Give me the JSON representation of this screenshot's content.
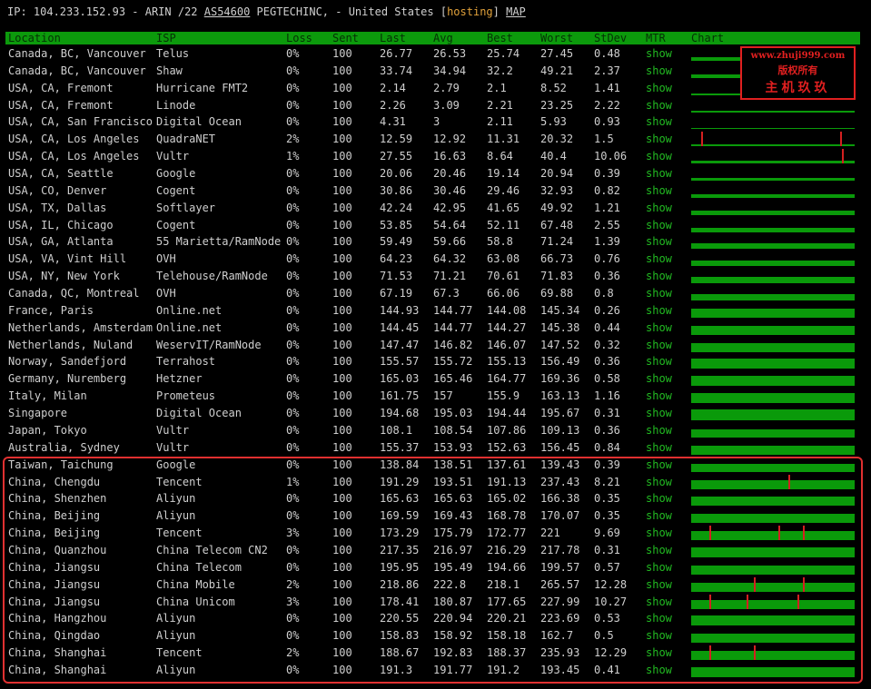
{
  "top": {
    "prefix": "IP: 104.233.152.93 - ARIN /22 ",
    "asn": "AS54600",
    "org": " PEGTECHINC, - United States [",
    "tag": "hosting",
    "close": "] ",
    "map": "MAP"
  },
  "columns": [
    "Location",
    "ISP",
    "Loss",
    "Sent",
    "Last",
    "Avg",
    "Best",
    "Worst",
    "StDev",
    "MTR",
    "Chart"
  ],
  "watermark": {
    "line1": "www.zhuji999.com",
    "line2": "版权所有",
    "line3": "主机玖玖"
  },
  "rows": [
    {
      "location": "Canada, BC, Vancouver",
      "isp": "Telus",
      "loss": "0%",
      "sent": "100",
      "last": "26.77",
      "avg": "26.53",
      "best": "25.74",
      "worst": "27.45",
      "stdev": "0.48",
      "mtr": "show",
      "chart": {
        "h": 4,
        "spikes": []
      }
    },
    {
      "location": "Canada, BC, Vancouver",
      "isp": "Shaw",
      "loss": "0%",
      "sent": "100",
      "last": "33.74",
      "avg": "34.94",
      "best": "32.2",
      "worst": "49.21",
      "stdev": "2.37",
      "mtr": "show",
      "chart": {
        "h": 4,
        "spikes": []
      }
    },
    {
      "location": "USA, CA, Fremont",
      "isp": "Hurricane FMT2",
      "loss": "0%",
      "sent": "100",
      "last": "2.14",
      "avg": "2.79",
      "best": "2.1",
      "worst": "8.52",
      "stdev": "1.41",
      "mtr": "show",
      "chart": {
        "h": 2,
        "spikes": []
      }
    },
    {
      "location": "USA, CA, Fremont",
      "isp": "Linode",
      "loss": "0%",
      "sent": "100",
      "last": "2.26",
      "avg": "3.09",
      "best": "2.21",
      "worst": "23.25",
      "stdev": "2.22",
      "mtr": "show",
      "chart": {
        "h": 2,
        "spikes": []
      }
    },
    {
      "location": "USA, CA, San Francisco",
      "isp": "Digital Ocean",
      "loss": "0%",
      "sent": "100",
      "last": "4.31",
      "avg": "3",
      "best": "2.11",
      "worst": "5.93",
      "stdev": "0.93",
      "mtr": "show",
      "chart": {
        "h": 1,
        "spikes": []
      }
    },
    {
      "location": "USA, CA, Los Angeles",
      "isp": "QuadraNET",
      "loss": "2%",
      "sent": "100",
      "last": "12.59",
      "avg": "12.92",
      "best": "11.31",
      "worst": "20.32",
      "stdev": "1.5",
      "mtr": "show",
      "chart": {
        "h": 2,
        "spikes": [
          6,
          92
        ]
      }
    },
    {
      "location": "USA, CA, Los Angeles",
      "isp": "Vultr",
      "loss": "1%",
      "sent": "100",
      "last": "27.55",
      "avg": "16.63",
      "best": "8.64",
      "worst": "40.4",
      "stdev": "10.06",
      "mtr": "show",
      "chart": {
        "h": 3,
        "spikes": [
          93
        ]
      }
    },
    {
      "location": "USA, CA, Seattle",
      "isp": "Google",
      "loss": "0%",
      "sent": "100",
      "last": "20.06",
      "avg": "20.46",
      "best": "19.14",
      "worst": "20.94",
      "stdev": "0.39",
      "mtr": "show",
      "chart": {
        "h": 3,
        "spikes": []
      }
    },
    {
      "location": "USA, CO, Denver",
      "isp": "Cogent",
      "loss": "0%",
      "sent": "100",
      "last": "30.86",
      "avg": "30.46",
      "best": "29.46",
      "worst": "32.93",
      "stdev": "0.82",
      "mtr": "show",
      "chart": {
        "h": 4,
        "spikes": []
      }
    },
    {
      "location": "USA, TX, Dallas",
      "isp": "Softlayer",
      "loss": "0%",
      "sent": "100",
      "last": "42.24",
      "avg": "42.95",
      "best": "41.65",
      "worst": "49.92",
      "stdev": "1.21",
      "mtr": "show",
      "chart": {
        "h": 5,
        "spikes": []
      }
    },
    {
      "location": "USA, IL, Chicago",
      "isp": "Cogent",
      "loss": "0%",
      "sent": "100",
      "last": "53.85",
      "avg": "54.64",
      "best": "52.11",
      "worst": "67.48",
      "stdev": "2.55",
      "mtr": "show",
      "chart": {
        "h": 5,
        "spikes": []
      }
    },
    {
      "location": "USA, GA, Atlanta",
      "isp": "55 Marietta/RamNode",
      "loss": "0%",
      "sent": "100",
      "last": "59.49",
      "avg": "59.66",
      "best": "58.8",
      "worst": "71.24",
      "stdev": "1.39",
      "mtr": "show",
      "chart": {
        "h": 6,
        "spikes": []
      }
    },
    {
      "location": "USA, VA, Vint Hill",
      "isp": "OVH",
      "loss": "0%",
      "sent": "100",
      "last": "64.23",
      "avg": "64.32",
      "best": "63.08",
      "worst": "66.73",
      "stdev": "0.76",
      "mtr": "show",
      "chart": {
        "h": 6,
        "spikes": []
      }
    },
    {
      "location": "USA, NY, New York",
      "isp": "Telehouse/RamNode",
      "loss": "0%",
      "sent": "100",
      "last": "71.53",
      "avg": "71.21",
      "best": "70.61",
      "worst": "71.83",
      "stdev": "0.36",
      "mtr": "show",
      "chart": {
        "h": 7,
        "spikes": []
      }
    },
    {
      "location": "Canada, QC, Montreal",
      "isp": "OVH",
      "loss": "0%",
      "sent": "100",
      "last": "67.19",
      "avg": "67.3",
      "best": "66.06",
      "worst": "69.88",
      "stdev": "0.8",
      "mtr": "show",
      "chart": {
        "h": 7,
        "spikes": []
      }
    },
    {
      "location": "France, Paris",
      "isp": "Online.net",
      "loss": "0%",
      "sent": "100",
      "last": "144.93",
      "avg": "144.77",
      "best": "144.08",
      "worst": "145.34",
      "stdev": "0.26",
      "mtr": "show",
      "chart": {
        "h": 10,
        "spikes": []
      }
    },
    {
      "location": "Netherlands, Amsterdam",
      "isp": "Online.net",
      "loss": "0%",
      "sent": "100",
      "last": "144.45",
      "avg": "144.77",
      "best": "144.27",
      "worst": "145.38",
      "stdev": "0.44",
      "mtr": "show",
      "chart": {
        "h": 10,
        "spikes": []
      }
    },
    {
      "location": "Netherlands, Nuland",
      "isp": "WeservIT/RamNode",
      "loss": "0%",
      "sent": "100",
      "last": "147.47",
      "avg": "146.82",
      "best": "146.07",
      "worst": "147.52",
      "stdev": "0.32",
      "mtr": "show",
      "chart": {
        "h": 10,
        "spikes": []
      }
    },
    {
      "location": "Norway, Sandefjord",
      "isp": "Terrahost",
      "loss": "0%",
      "sent": "100",
      "last": "155.57",
      "avg": "155.72",
      "best": "155.13",
      "worst": "156.49",
      "stdev": "0.36",
      "mtr": "show",
      "chart": {
        "h": 11,
        "spikes": []
      }
    },
    {
      "location": "Germany, Nuremberg",
      "isp": "Hetzner",
      "loss": "0%",
      "sent": "100",
      "last": "165.03",
      "avg": "165.46",
      "best": "164.77",
      "worst": "169.36",
      "stdev": "0.58",
      "mtr": "show",
      "chart": {
        "h": 11,
        "spikes": []
      }
    },
    {
      "location": "Italy, Milan",
      "isp": "Prometeus",
      "loss": "0%",
      "sent": "100",
      "last": "161.75",
      "avg": "157",
      "best": "155.9",
      "worst": "163.13",
      "stdev": "1.16",
      "mtr": "show",
      "chart": {
        "h": 11,
        "spikes": []
      }
    },
    {
      "location": "Singapore",
      "isp": "Digital Ocean",
      "loss": "0%",
      "sent": "100",
      "last": "194.68",
      "avg": "195.03",
      "best": "194.44",
      "worst": "195.67",
      "stdev": "0.31",
      "mtr": "show",
      "chart": {
        "h": 12,
        "spikes": []
      }
    },
    {
      "location": "Japan, Tokyo",
      "isp": "Vultr",
      "loss": "0%",
      "sent": "100",
      "last": "108.1",
      "avg": "108.54",
      "best": "107.86",
      "worst": "109.13",
      "stdev": "0.36",
      "mtr": "show",
      "chart": {
        "h": 9,
        "spikes": []
      }
    },
    {
      "location": "Australia, Sydney",
      "isp": "Vultr",
      "loss": "0%",
      "sent": "100",
      "last": "155.37",
      "avg": "153.93",
      "best": "152.63",
      "worst": "156.45",
      "stdev": "0.84",
      "mtr": "show",
      "chart": {
        "h": 10,
        "spikes": []
      }
    },
    {
      "location": "Taiwan, Taichung",
      "isp": "Google",
      "loss": "0%",
      "sent": "100",
      "last": "138.84",
      "avg": "138.51",
      "best": "137.61",
      "worst": "139.43",
      "stdev": "0.39",
      "mtr": "show",
      "chart": {
        "h": 9,
        "spikes": []
      }
    },
    {
      "location": "China, Chengdu",
      "isp": "Tencent",
      "loss": "1%",
      "sent": "100",
      "last": "191.29",
      "avg": "193.51",
      "best": "191.13",
      "worst": "237.43",
      "stdev": "8.21",
      "mtr": "show",
      "chart": {
        "h": 10,
        "spikes": [
          60
        ]
      }
    },
    {
      "location": "China, Shenzhen",
      "isp": "Aliyun",
      "loss": "0%",
      "sent": "100",
      "last": "165.63",
      "avg": "165.63",
      "best": "165.02",
      "worst": "166.38",
      "stdev": "0.35",
      "mtr": "show",
      "chart": {
        "h": 10,
        "spikes": []
      }
    },
    {
      "location": "China, Beijing",
      "isp": "Aliyun",
      "loss": "0%",
      "sent": "100",
      "last": "169.59",
      "avg": "169.43",
      "best": "168.78",
      "worst": "170.07",
      "stdev": "0.35",
      "mtr": "show",
      "chart": {
        "h": 10,
        "spikes": []
      }
    },
    {
      "location": "China, Beijing",
      "isp": "Tencent",
      "loss": "3%",
      "sent": "100",
      "last": "173.29",
      "avg": "175.79",
      "best": "172.77",
      "worst": "221",
      "stdev": "9.69",
      "mtr": "show",
      "chart": {
        "h": 10,
        "spikes": [
          11,
          54,
          69
        ]
      }
    },
    {
      "location": "China, Quanzhou",
      "isp": "China Telecom CN2",
      "loss": "0%",
      "sent": "100",
      "last": "217.35",
      "avg": "216.97",
      "best": "216.29",
      "worst": "217.78",
      "stdev": "0.31",
      "mtr": "show",
      "chart": {
        "h": 11,
        "spikes": []
      }
    },
    {
      "location": "China, Jiangsu",
      "isp": "China Telecom",
      "loss": "0%",
      "sent": "100",
      "last": "195.95",
      "avg": "195.49",
      "best": "194.66",
      "worst": "199.57",
      "stdev": "0.57",
      "mtr": "show",
      "chart": {
        "h": 10,
        "spikes": []
      }
    },
    {
      "location": "China, Jiangsu",
      "isp": "China Mobile",
      "loss": "2%",
      "sent": "100",
      "last": "218.86",
      "avg": "222.8",
      "best": "218.1",
      "worst": "265.57",
      "stdev": "12.28",
      "mtr": "show",
      "chart": {
        "h": 10,
        "spikes": [
          39,
          69
        ]
      }
    },
    {
      "location": "China, Jiangsu",
      "isp": "China Unicom",
      "loss": "3%",
      "sent": "100",
      "last": "178.41",
      "avg": "180.87",
      "best": "177.65",
      "worst": "227.99",
      "stdev": "10.27",
      "mtr": "show",
      "chart": {
        "h": 10,
        "spikes": [
          11,
          34,
          66
        ]
      }
    },
    {
      "location": "China, Hangzhou",
      "isp": "Aliyun",
      "loss": "0%",
      "sent": "100",
      "last": "220.55",
      "avg": "220.94",
      "best": "220.21",
      "worst": "223.69",
      "stdev": "0.53",
      "mtr": "show",
      "chart": {
        "h": 11,
        "spikes": []
      }
    },
    {
      "location": "China, Qingdao",
      "isp": "Aliyun",
      "loss": "0%",
      "sent": "100",
      "last": "158.83",
      "avg": "158.92",
      "best": "158.18",
      "worst": "162.7",
      "stdev": "0.5",
      "mtr": "show",
      "chart": {
        "h": 10,
        "spikes": []
      }
    },
    {
      "location": "China, Shanghai",
      "isp": "Tencent",
      "loss": "2%",
      "sent": "100",
      "last": "188.67",
      "avg": "192.83",
      "best": "188.37",
      "worst": "235.93",
      "stdev": "12.29",
      "mtr": "show",
      "chart": {
        "h": 10,
        "spikes": [
          11,
          39
        ]
      }
    },
    {
      "location": "China, Shanghai",
      "isp": "Aliyun",
      "loss": "0%",
      "sent": "100",
      "last": "191.3",
      "avg": "191.77",
      "best": "191.2",
      "worst": "193.45",
      "stdev": "0.41",
      "mtr": "show",
      "chart": {
        "h": 11,
        "spikes": []
      }
    }
  ]
}
